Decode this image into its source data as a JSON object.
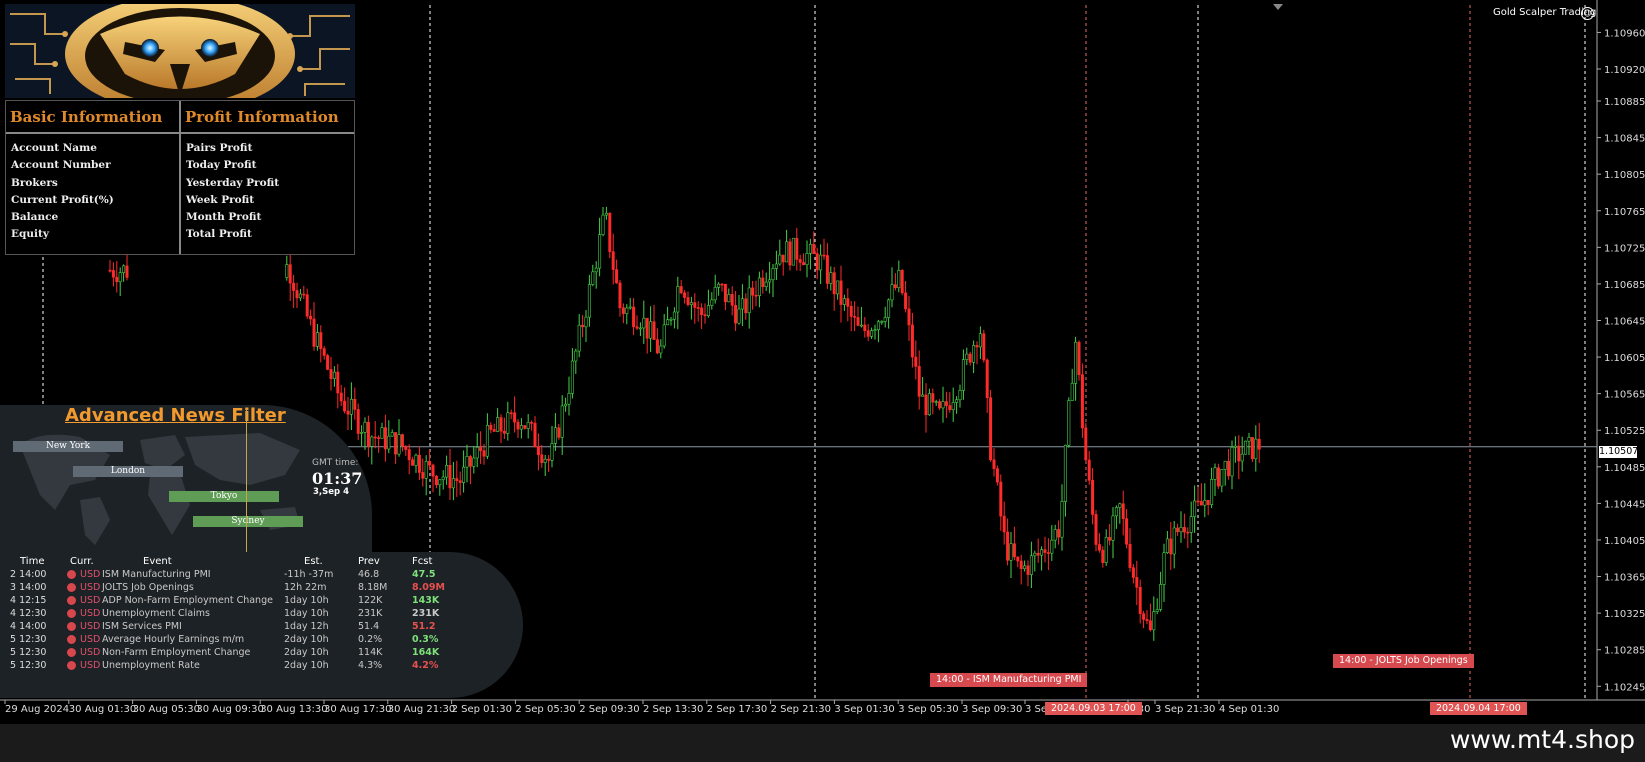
{
  "chart_data": {
    "type": "candlestick",
    "symbol_label": "Gold Scalper Trading",
    "y_ticks": [
      "1.10960",
      "1.10920",
      "1.10885",
      "1.10845",
      "1.10805",
      "1.10765",
      "1.10725",
      "1.10685",
      "1.10645",
      "1.10605",
      "1.10565",
      "1.10525",
      "1.10485",
      "1.10445",
      "1.10405",
      "1.10365",
      "1.10325",
      "1.10285",
      "1.10245"
    ],
    "current_price": "1.10507",
    "x_ticks": [
      "29 Aug 2024",
      "30 Aug 01:30",
      "30 Aug 05:30",
      "30 Aug 09:30",
      "30 Aug 13:30",
      "30 Aug 17:30",
      "30 Aug 21:30",
      "2 Sep 01:30",
      "2 Sep 05:30",
      "2 Sep 09:30",
      "2 Sep 13:30",
      "2 Sep 17:30",
      "2 Sep 21:30",
      "3 Sep 01:30",
      "3 Sep 05:30",
      "3 Sep 09:30",
      "3 Se",
      "7:30",
      "3 Sep 21:30",
      "4 Sep 01:30"
    ],
    "ylim": [
      1.1023,
      1.1099
    ],
    "colors": {
      "bull": "#44d34a",
      "bear": "#ff2a2a"
    }
  },
  "brand": {
    "label": "Gold Scalper Trading",
    "smile": "☺"
  },
  "info": {
    "basic_title": "Basic Information",
    "profit_title": "Profit Information",
    "basic_rows": [
      "Account Name",
      "Account Number",
      "Brokers",
      "Current Profit(%)",
      "Balance",
      "Equity"
    ],
    "profit_rows": [
      "Pairs Profit",
      "Today Profit",
      "Yesterday Profit",
      "Week Profit",
      "Month Profit",
      "Total Profit"
    ]
  },
  "news": {
    "title": "Advanced News Filter",
    "sessions": [
      {
        "name": "New York",
        "style": "grey"
      },
      {
        "name": "London",
        "style": "grey"
      },
      {
        "name": "Tokyo",
        "style": "green"
      },
      {
        "name": "Sydney",
        "style": "green"
      }
    ],
    "gmt_label": "GMT time:",
    "gmt_time": "01:37",
    "gmt_date": "3,Sep 4",
    "headers": {
      "time": "Time",
      "curr": "Curr.",
      "event": "Event",
      "est": "Est.",
      "prev": "Prev",
      "fcst": "Fcst"
    },
    "rows": [
      {
        "time": "2 14:00",
        "curr": "USD",
        "event": "ISM Manufacturing PMI",
        "est": "-11h -37m",
        "prev": "46.8",
        "fcst": "47.5",
        "fcst_color": "#7ee07a"
      },
      {
        "time": "3 14:00",
        "curr": "USD",
        "event": "JOLTS Job Openings",
        "est": "12h 22m",
        "prev": "8.18M",
        "fcst": "8.09M",
        "fcst_color": "#e8504f"
      },
      {
        "time": "4 12:15",
        "curr": "USD",
        "event": "ADP Non-Farm Employment Change",
        "est": "1day 10h",
        "prev": "122K",
        "fcst": "143K",
        "fcst_color": "#7ee07a"
      },
      {
        "time": "4 12:30",
        "curr": "USD",
        "event": "Unemployment Claims",
        "est": "1day 10h",
        "prev": "231K",
        "fcst": "231K",
        "fcst_color": "#c9c9c9"
      },
      {
        "time": "4 14:00",
        "curr": "USD",
        "event": "ISM Services PMI",
        "est": "1day 12h",
        "prev": "51.4",
        "fcst": "51.2",
        "fcst_color": "#e8504f"
      },
      {
        "time": "5 12:30",
        "curr": "USD",
        "event": "Average Hourly Earnings m/m",
        "est": "2day 10h",
        "prev": "0.2%",
        "fcst": "0.3%",
        "fcst_color": "#7ee07a"
      },
      {
        "time": "5 12:30",
        "curr": "USD",
        "event": "Non-Farm Employment Change",
        "est": "2day 10h",
        "prev": "114K",
        "fcst": "164K",
        "fcst_color": "#7ee07a"
      },
      {
        "time": "5 12:30",
        "curr": "USD",
        "event": "Unemployment Rate",
        "est": "2day 10h",
        "prev": "4.3%",
        "fcst": "4.2%",
        "fcst_color": "#e8504f"
      }
    ]
  },
  "annotations": {
    "event_ism": "14:00 - ISM Manufacturing PMI",
    "event_jolts": "14:00 - JOLTS Job Openings",
    "date_1": "2024.09.03 17:00",
    "date_2": "2024.09.04 17:00"
  },
  "footer": {
    "site": "www.mt4.shop"
  }
}
